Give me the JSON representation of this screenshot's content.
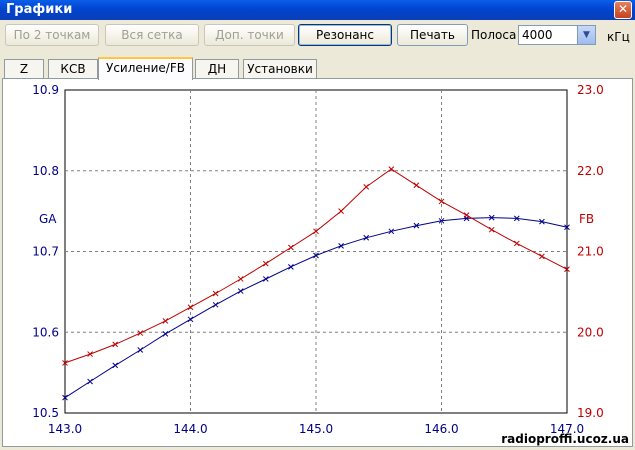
{
  "window": {
    "title": "Графики",
    "close": "✕"
  },
  "toolbar": {
    "btn_two_points": "По 2 точкам",
    "btn_whole_grid": "Вся сетка",
    "btn_extra_points": "Доп. точки",
    "btn_resonance": "Резонанс",
    "btn_print": "Печать",
    "band_label": "Полоса",
    "band_value": "4000",
    "band_unit": "кГц"
  },
  "tabs": [
    {
      "label": "Z"
    },
    {
      "label": "КСВ"
    },
    {
      "label": "Усиление/FB",
      "active": true
    },
    {
      "label": "ДН"
    },
    {
      "label": "Установки"
    }
  ],
  "watermark": "radioproffi.ucoz.ua",
  "colors": {
    "ga": "#00008b",
    "fb": "#c00000",
    "grid": "#808080"
  },
  "chart_data": {
    "type": "line",
    "x_ticks": [
      "143.0",
      "144.0",
      "145.0",
      "146.0",
      "147.0"
    ],
    "xlim": [
      143.0,
      147.0
    ],
    "y_left": {
      "label": "GA",
      "ylim": [
        10.5,
        10.9
      ],
      "ticks": [
        "10.9",
        "10.8",
        "10.7",
        "10.6",
        "10.5"
      ]
    },
    "y_right": {
      "label": "FB",
      "ylim": [
        19.0,
        23.0
      ],
      "ticks": [
        "23.0",
        "22.0",
        "21.0",
        "20.0",
        "19.0"
      ]
    },
    "grid": true,
    "series": [
      {
        "name": "GA",
        "axis": "left",
        "x": [
          143.0,
          143.2,
          143.4,
          143.6,
          143.8,
          144.0,
          144.2,
          144.4,
          144.6,
          144.8,
          145.0,
          145.2,
          145.4,
          145.6,
          145.8,
          146.0,
          146.2,
          146.4,
          146.6,
          146.8,
          147.0
        ],
        "y": [
          10.519,
          10.539,
          10.559,
          10.578,
          10.598,
          10.616,
          10.634,
          10.651,
          10.666,
          10.681,
          10.695,
          10.707,
          10.717,
          10.725,
          10.732,
          10.738,
          10.741,
          10.742,
          10.741,
          10.737,
          10.73
        ]
      },
      {
        "name": "FB",
        "axis": "right",
        "x": [
          143.0,
          143.2,
          143.4,
          143.6,
          143.8,
          144.0,
          144.2,
          144.4,
          144.6,
          144.8,
          145.0,
          145.2,
          145.4,
          145.6,
          145.8,
          146.0,
          146.2,
          146.4,
          146.6,
          146.8,
          147.0
        ],
        "y": [
          19.62,
          19.73,
          19.85,
          19.99,
          20.14,
          20.31,
          20.48,
          20.66,
          20.85,
          21.05,
          21.25,
          21.5,
          21.8,
          22.02,
          21.82,
          21.62,
          21.45,
          21.27,
          21.1,
          20.94,
          20.78
        ]
      }
    ]
  }
}
